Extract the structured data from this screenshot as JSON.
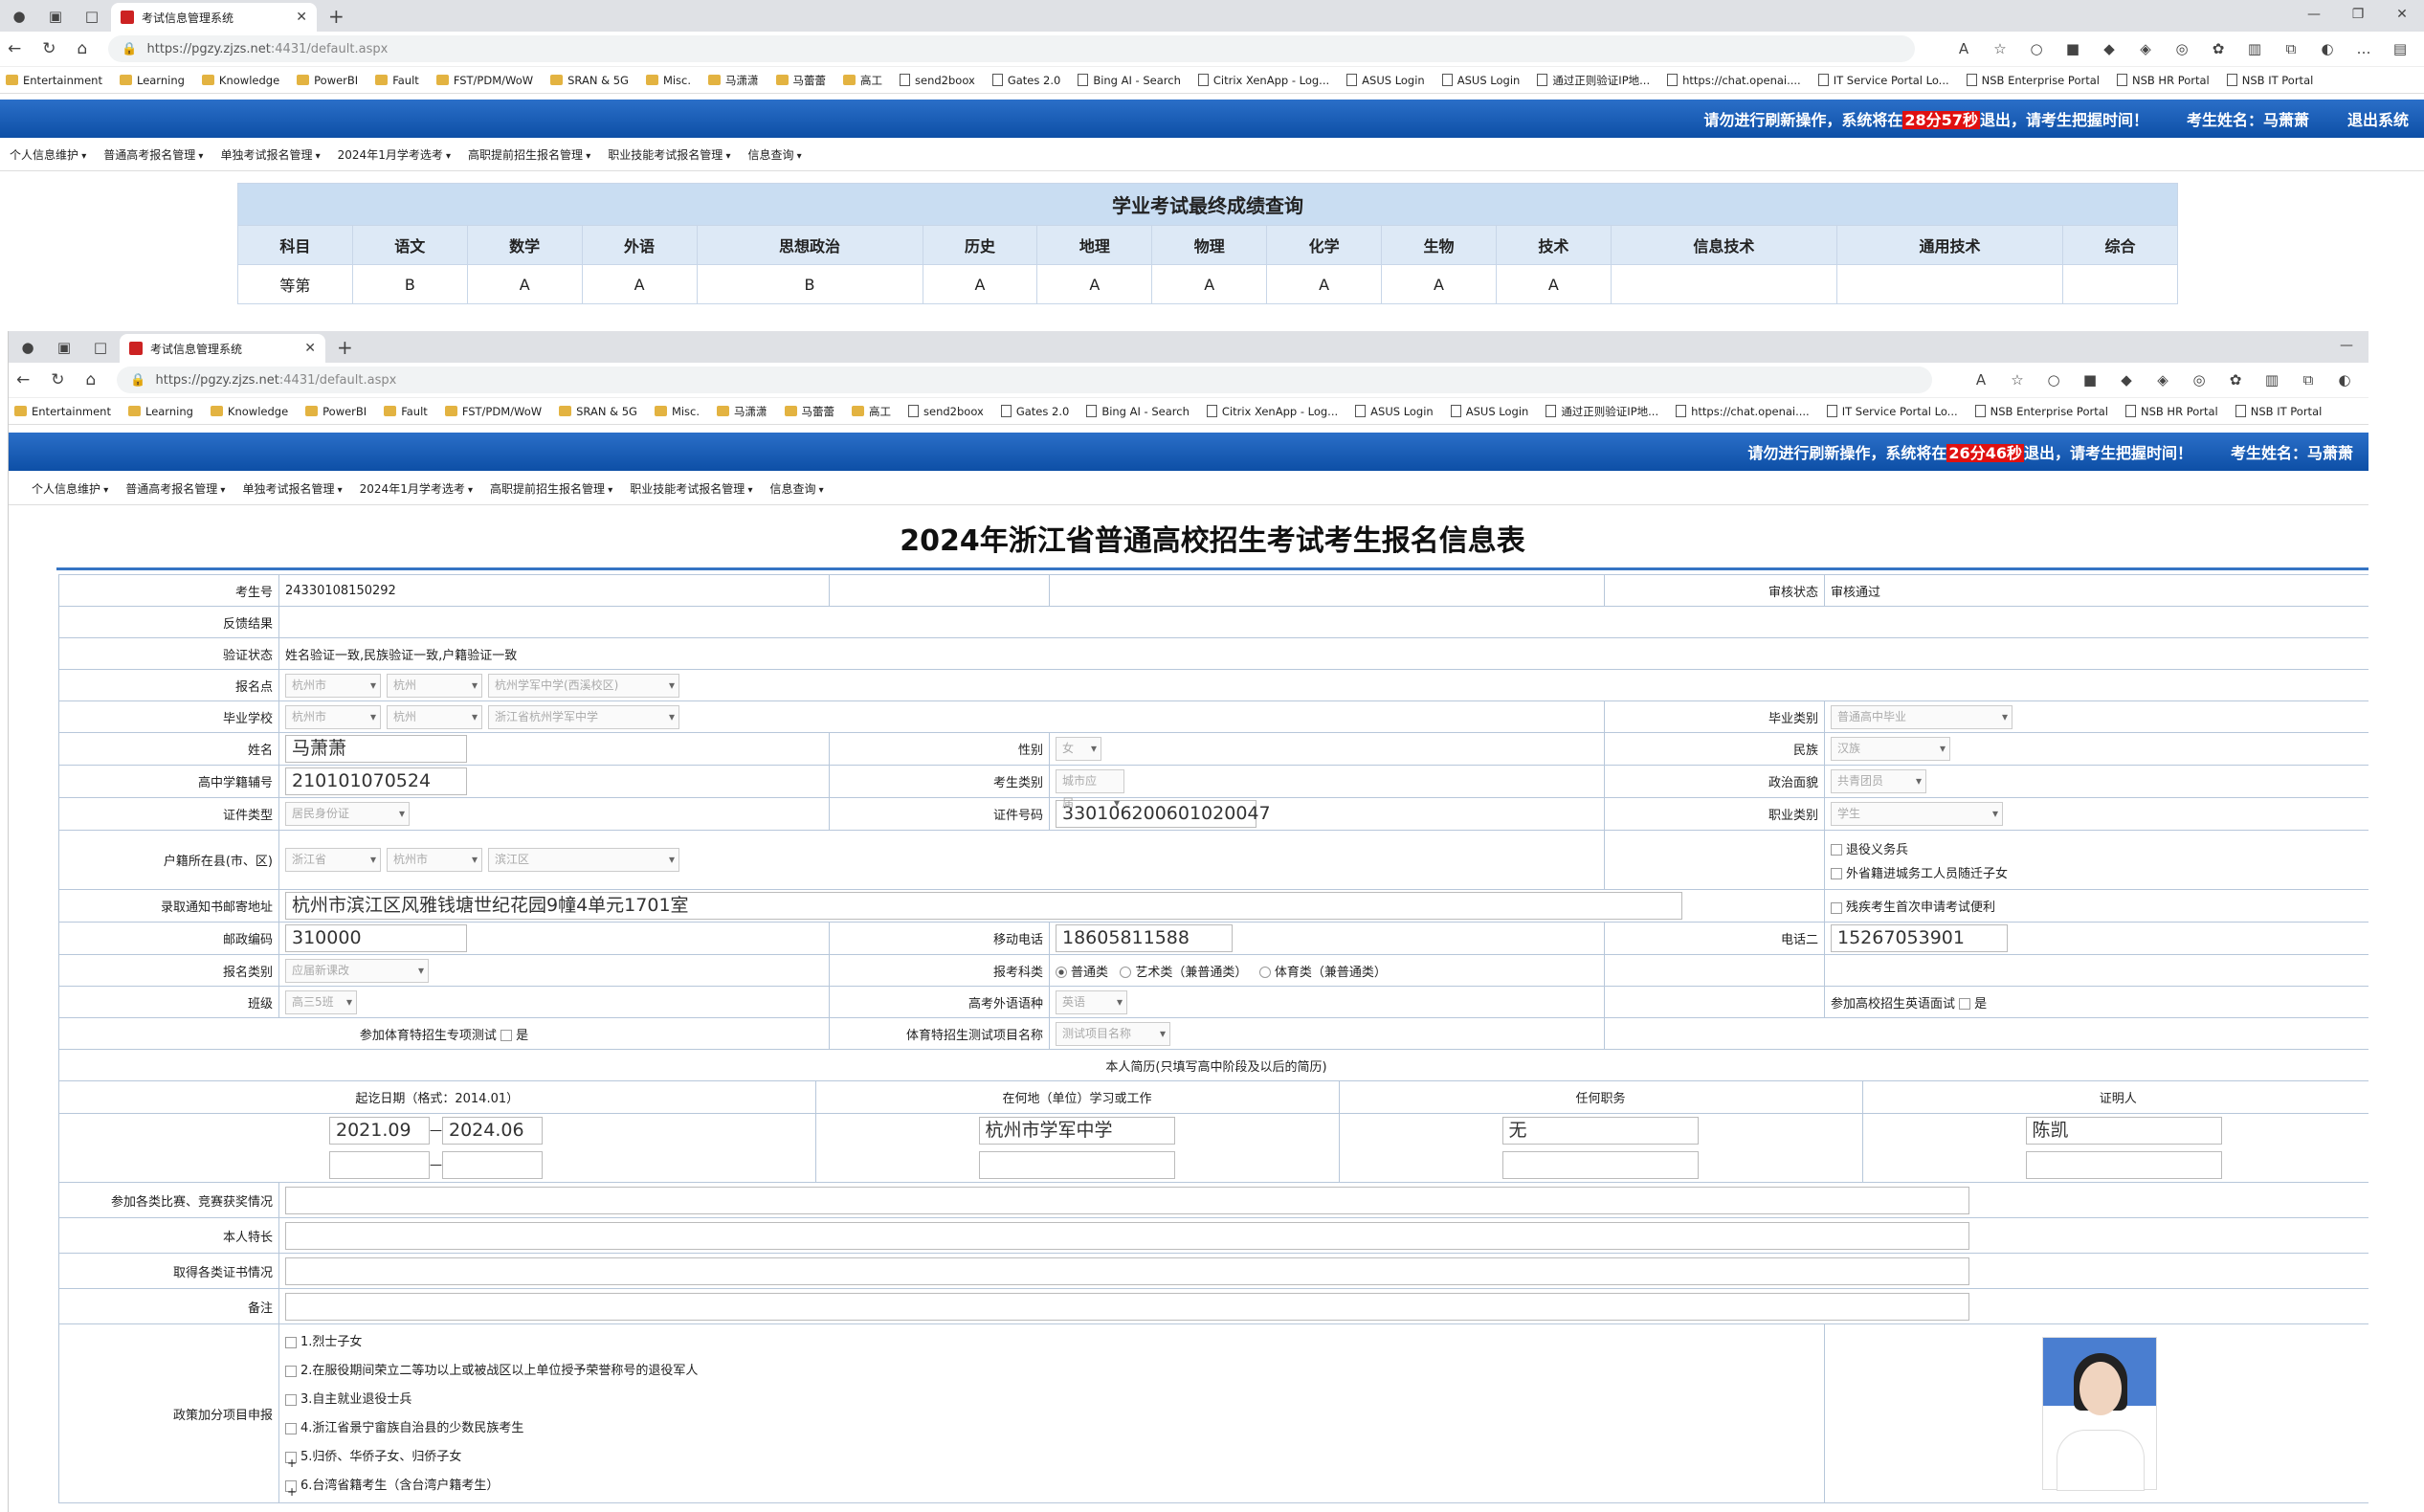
{
  "browser": {
    "tab_title": "考试信息管理系统",
    "url_host": "https://pgzy.zjzs.net",
    "url_rest": ":4431/default.aspx",
    "bookmarks": [
      {
        "label": "Entertainment",
        "type": "folder"
      },
      {
        "label": "Learning",
        "type": "folder"
      },
      {
        "label": "Knowledge",
        "type": "folder"
      },
      {
        "label": "PowerBI",
        "type": "folder"
      },
      {
        "label": "Fault",
        "type": "folder"
      },
      {
        "label": "FST/PDM/WoW",
        "type": "folder"
      },
      {
        "label": "SRAN & 5G",
        "type": "folder"
      },
      {
        "label": "Misc.",
        "type": "folder"
      },
      {
        "label": "马潇潇",
        "type": "folder"
      },
      {
        "label": "马蕾蕾",
        "type": "folder"
      },
      {
        "label": "高工",
        "type": "folder"
      },
      {
        "label": "send2boox",
        "type": "page"
      },
      {
        "label": "Gates 2.0",
        "type": "page"
      },
      {
        "label": "Bing AI - Search",
        "type": "page"
      },
      {
        "label": "Citrix XenApp - Log...",
        "type": "page"
      },
      {
        "label": "ASUS Login",
        "type": "page"
      },
      {
        "label": "ASUS Login",
        "type": "page"
      },
      {
        "label": "通过正则验证IP地...",
        "type": "page"
      },
      {
        "label": "https://chat.openai....",
        "type": "page"
      },
      {
        "label": "IT Service Portal Lo...",
        "type": "page"
      },
      {
        "label": "NSB Enterprise Portal",
        "type": "page"
      },
      {
        "label": "NSB HR Portal",
        "type": "page"
      },
      {
        "label": "NSB IT Portal",
        "type": "page"
      }
    ]
  },
  "window1": {
    "banner": {
      "pre": "请勿进行刷新操作，系统将在",
      "countdown": "28分57秒",
      "post": "退出，请考生把握时间！",
      "student": "考生姓名：马萧萧",
      "logout": "退出系统"
    },
    "score": {
      "caption": "学业考试最终成绩查询",
      "headers": [
        "科目",
        "语文",
        "数学",
        "外语",
        "思想政治",
        "历史",
        "地理",
        "物理",
        "化学",
        "生物",
        "技术",
        "信息技术",
        "通用技术",
        "综合"
      ],
      "row": [
        "等第",
        "B",
        "A",
        "A",
        "B",
        "A",
        "A",
        "A",
        "A",
        "A",
        "A",
        "",
        "",
        ""
      ]
    }
  },
  "menu": [
    "个人信息维护",
    "普通高考报名管理",
    "单独考试报名管理",
    "2024年1月学考选考",
    "高职提前招生报名管理",
    "职业技能考试报名管理",
    "信息查询"
  ],
  "window2": {
    "banner": {
      "pre": "请勿进行刷新操作，系统将在",
      "countdown": "26分46秒",
      "post": "退出，请考生把握时间！",
      "student": "考生姓名：马萧萧"
    },
    "title": "2024年浙江省普通高校招生考试考生报名信息表",
    "form": {
      "l_kaoshenghao": "考生号",
      "kaoshenghao": "24330108150292",
      "l_shenhe": "审核状态",
      "shenhe": "审核通过",
      "l_fankui": "反馈结果",
      "l_yanzheng": "验证状态",
      "yanzheng": "姓名验证一致,民族验证一致,户籍验证一致",
      "l_baomingdian": "报名点",
      "bmd1": "杭州市",
      "bmd2": "杭州",
      "bmd3": "杭州学军中学(西溪校区)",
      "l_biyexuexiao": "毕业学校",
      "byx1": "杭州市",
      "byx2": "杭州",
      "byx3": "浙江省杭州学军中学",
      "l_biyeleibie": "毕业类别",
      "biyeleibie": "普通高中毕业",
      "l_xingming": "姓名",
      "xingming": "马萧萧",
      "l_xingbie": "性别",
      "xingbie": "女",
      "l_minzu": "民族",
      "minzu": "汉族",
      "l_xueji": "高中学籍辅号",
      "xueji": "210101070524",
      "l_kaoshengleibie": "考生类别",
      "kaoshengleibie": "城市应届",
      "l_zhengzhi": "政治面貌",
      "zhengzhi": "共青团员",
      "l_zhengjianleixing": "证件类型",
      "zhengjianleixing": "居民身份证",
      "l_zhengjianhao": "证件号码",
      "zhengjianhao": "330106200601020047",
      "l_zhiye": "职业类别",
      "zhiye": "学生",
      "l_huji": "户籍所在县(市、区)",
      "hj1": "浙江省",
      "hj2": "杭州市",
      "hj3": "滨江区",
      "tuiyi": "退役义务兵",
      "waisheng": "外省籍进城务工人员随迁子女",
      "l_dizhi": "录取通知书邮寄地址",
      "dizhi": "杭州市滨江区风雅钱塘世纪花园9幢4单元1701室",
      "canji": "残疾考生首次申请考试便利",
      "l_youbian": "邮政编码",
      "youbian": "310000",
      "l_yidong": "移动电话",
      "yidong": "18605811588",
      "l_dianhua2": "电话二",
      "dianhua2": "15267053901",
      "l_baomingleibie": "报名类别",
      "baomingleibie": "应届新课改",
      "l_baokaokelei": "报考科类",
      "kelei1": "普通类",
      "kelei2": "艺术类（兼普通类）",
      "kelei3": "体育类（兼普通类）",
      "l_banji": "班级",
      "banji": "高三5班",
      "l_waiyu": "高考外语语种",
      "waiyu": "英语",
      "l_yingyumianshi": "参加高校招生英语面试",
      "shi": "是",
      "l_tiyu": "参加体育特招生专项测试",
      "l_tiyuxiangmu": "体育特招生测试项目名称",
      "tiyuxiangmu": "测试项目名称",
      "jianli_title": "本人简历(只填写高中阶段及以后的简历)",
      "jl_h1": "起讫日期（格式：2014.01）",
      "jl_h2": "在何地（单位）学习或工作",
      "jl_h3": "任何职务",
      "jl_h4": "证明人",
      "jl_start": "2021.09",
      "jl_end": "2024.06",
      "jl_place": "杭州市学军中学",
      "jl_duty": "无",
      "jl_witness": "陈凯",
      "l_bisai": "参加各类比赛、竞赛获奖情况",
      "l_techang": "本人特长",
      "l_zhengshu": "取得各类证书情况",
      "l_beizhu": "备注",
      "l_zhengce": "政策加分项目申报",
      "zc1": "1.烈士子女",
      "zc2": "2.在服役期间荣立二等功以上或被战区以上单位授予荣誉称号的退役军人",
      "zc3": "3.自主就业退役士兵",
      "zc4": "4.浙江省景宁畲族自治县的少数民族考生",
      "zc5": "5.归侨、华侨子女、归侨子女",
      "zc6": "6.台湾省籍考生（含台湾户籍考生）"
    }
  }
}
